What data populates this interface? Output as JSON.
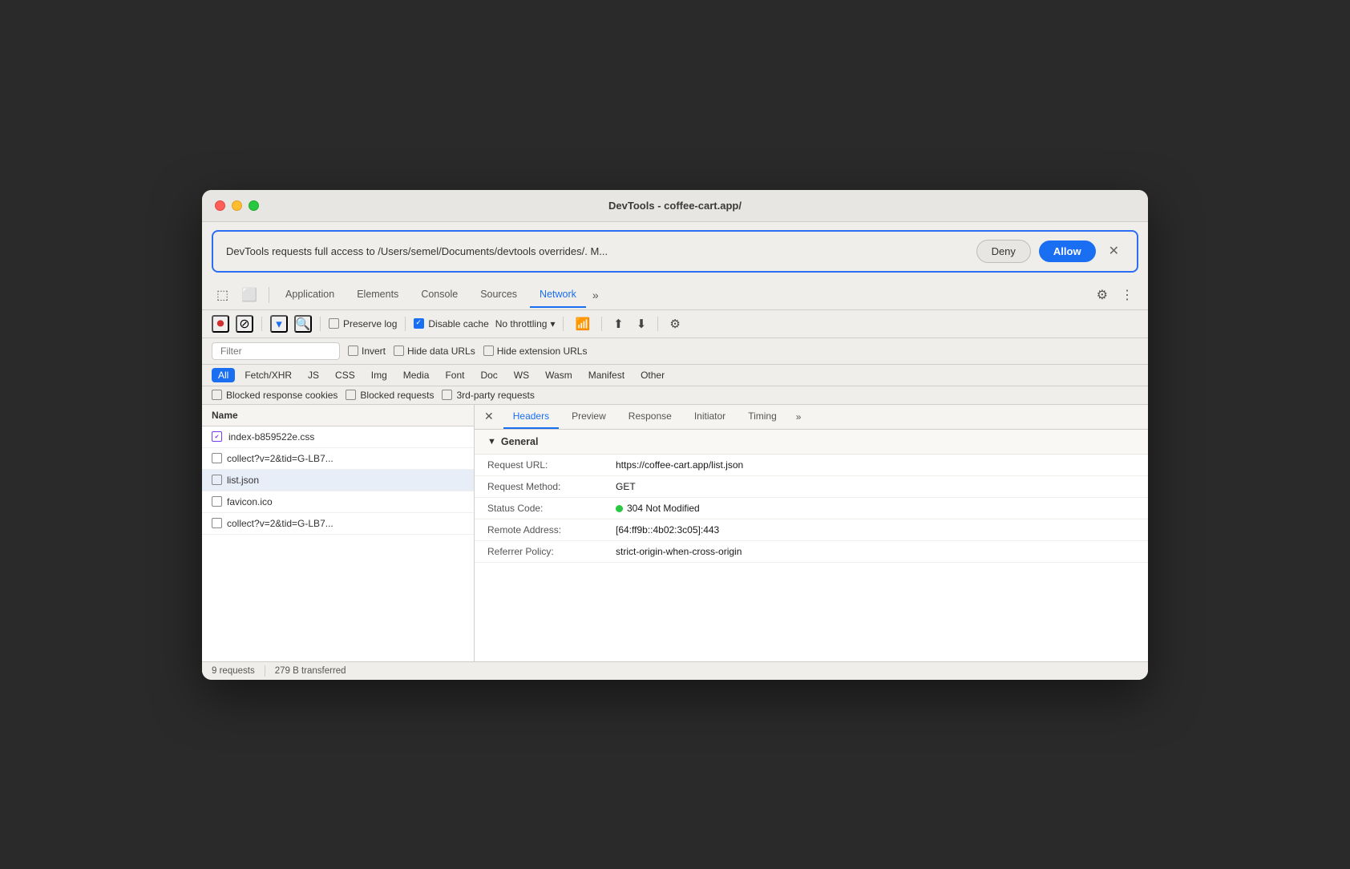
{
  "window": {
    "title": "DevTools - coffee-cart.app/"
  },
  "permission_bar": {
    "text": "DevTools requests full access to /Users/semel/Documents/devtools overrides/. M...",
    "deny_label": "Deny",
    "allow_label": "Allow"
  },
  "tabs": {
    "items": [
      {
        "label": "Application"
      },
      {
        "label": "Elements"
      },
      {
        "label": "Console"
      },
      {
        "label": "Sources"
      },
      {
        "label": "Network",
        "active": true
      }
    ]
  },
  "network_toolbar": {
    "preserve_log": "Preserve log",
    "disable_cache": "Disable cache",
    "no_throttling": "No throttling"
  },
  "filter": {
    "placeholder": "Filter",
    "invert": "Invert",
    "hide_data_urls": "Hide data URLs",
    "hide_extension_urls": "Hide extension URLs"
  },
  "type_filters": [
    {
      "label": "All",
      "active": true
    },
    {
      "label": "Fetch/XHR"
    },
    {
      "label": "JS"
    },
    {
      "label": "CSS"
    },
    {
      "label": "Img"
    },
    {
      "label": "Media"
    },
    {
      "label": "Font"
    },
    {
      "label": "Doc"
    },
    {
      "label": "WS"
    },
    {
      "label": "Wasm"
    },
    {
      "label": "Manifest"
    },
    {
      "label": "Other"
    }
  ],
  "extra_filters": {
    "blocked_cookies": "Blocked response cookies",
    "blocked_requests": "Blocked requests",
    "third_party": "3rd-party requests"
  },
  "file_list": {
    "header": "Name",
    "items": [
      {
        "name": "index-b859522e.css",
        "css": true
      },
      {
        "name": "collect?v=2&tid=G-LB7..."
      },
      {
        "name": "list.json",
        "selected": true
      },
      {
        "name": "favicon.ico"
      },
      {
        "name": "collect?v=2&tid=G-LB7..."
      }
    ]
  },
  "details": {
    "tabs": [
      {
        "label": "Headers",
        "active": true
      },
      {
        "label": "Preview"
      },
      {
        "label": "Response"
      },
      {
        "label": "Initiator"
      },
      {
        "label": "Timing"
      }
    ],
    "general": {
      "section_title": "General",
      "properties": [
        {
          "key": "Request URL:",
          "value": "https://coffee-cart.app/list.json"
        },
        {
          "key": "Request Method:",
          "value": "GET"
        },
        {
          "key": "Status Code:",
          "value": "304 Not Modified",
          "status_dot": true
        },
        {
          "key": "Remote Address:",
          "value": "[64:ff9b::4b02:3c05]:443"
        },
        {
          "key": "Referrer Policy:",
          "value": "strict-origin-when-cross-origin"
        }
      ]
    }
  },
  "status_bar": {
    "requests": "9 requests",
    "transferred": "279 B transferred"
  }
}
